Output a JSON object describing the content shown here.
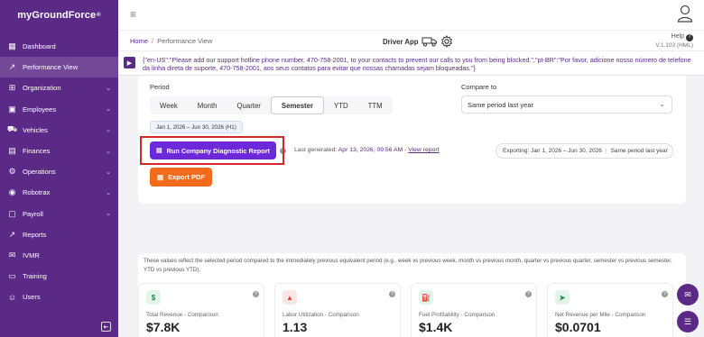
{
  "brand": {
    "name": "myGroundForce",
    "mark": "®"
  },
  "sidebar": {
    "items": [
      {
        "label": "Dashboard",
        "icon": "dashboard-icon",
        "glyph": "▦",
        "chevron": false
      },
      {
        "label": "Performance View",
        "icon": "chart-icon",
        "glyph": "↗",
        "chevron": false,
        "active": true
      },
      {
        "label": "Organization",
        "icon": "organization-icon",
        "glyph": "⊞",
        "chevron": true
      },
      {
        "label": "Employees",
        "icon": "employees-icon",
        "glyph": "▣",
        "chevron": true
      },
      {
        "label": "Vehicles",
        "icon": "vehicle-icon",
        "glyph": "⛟",
        "chevron": true
      },
      {
        "label": "Finances",
        "icon": "finances-icon",
        "glyph": "▤",
        "chevron": true
      },
      {
        "label": "Operations",
        "icon": "operations-icon",
        "glyph": "⚙",
        "chevron": true
      },
      {
        "label": "Robotrax",
        "icon": "robot-icon",
        "glyph": "◉",
        "chevron": true
      },
      {
        "label": "Payroll",
        "icon": "payroll-icon",
        "glyph": "▢",
        "chevron": true
      },
      {
        "label": "Reports",
        "icon": "reports-icon",
        "glyph": "↗",
        "chevron": false
      },
      {
        "label": "IVMR",
        "icon": "ivmr-icon",
        "glyph": "✉",
        "chevron": false
      },
      {
        "label": "Training",
        "icon": "training-icon",
        "glyph": "▭",
        "chevron": false
      },
      {
        "label": "Users",
        "icon": "users-icon",
        "glyph": "☺",
        "chevron": false
      }
    ]
  },
  "breadcrumb": {
    "home": "Home",
    "sep": "/",
    "current": "Performance View"
  },
  "driver_app": {
    "label": "Driver App"
  },
  "help": {
    "label": "Help",
    "version": "V.1.103 (HML)"
  },
  "notice": {
    "text": "{\"en-US\":\"Please add our support hotline phone number, 470-758-2001, to your contacts to prevent our calls to you from being blocked.\",\"pt-BR\":\"Por favor, adicione nosso número de telefone da linha direta de suporte, 470-758-2001, aos seus contatos para evitar que nossas chamadas sejam bloqueadas.\"}"
  },
  "period": {
    "label": "Period",
    "tabs": [
      "Week",
      "Month",
      "Quarter",
      "Semester",
      "YTD",
      "TTM"
    ],
    "active": "Semester",
    "range_chip": "Jan 1, 2026 – Jun 30, 2026 (H1)"
  },
  "compare": {
    "label": "Compare to",
    "value": "Same period last year"
  },
  "run_report": {
    "label": "Run Company Diagnostic Report"
  },
  "last_generated": {
    "prefix": "Last generated:",
    "date": "Apr 13, 2026, 09:56 AM",
    "dash": " - ",
    "link": "View report"
  },
  "exporting": {
    "range": "Exporting: Jan 1, 2026 – Jun 30, 2026",
    "compare": "Same period last year"
  },
  "export_pdf": {
    "label": "Export PDF"
  },
  "explanation": "These values reflect the selected period compared to the immediately previous equivalent period (e.g., week vs previous week, month vs previous month, quarter vs previous quarter, semester vs previous semester, YTD vs previous YTD).",
  "kpis": [
    {
      "label": "Total Revenue - Comparison",
      "value": "$7.8K",
      "icon": "dollar-icon",
      "glyph": "$",
      "color": "#1b8a4a",
      "bg": "#e3f5ea"
    },
    {
      "label": "Labor Utilization - Comparison",
      "value": "1.13",
      "icon": "bar-chart-icon",
      "glyph": "▲",
      "color": "#d64545",
      "bg": "#fbe6e6"
    },
    {
      "label": "Fuel Profitability - Comparison",
      "value": "$1.4K",
      "icon": "fuel-icon",
      "glyph": "⛽",
      "color": "#1b8a4a",
      "bg": "#e3f5ea"
    },
    {
      "label": "Net Revenue per Mile - Comparison",
      "value": "$0.0701",
      "icon": "send-icon",
      "glyph": "➤",
      "color": "#1b8a4a",
      "bg": "#e3f5ea"
    }
  ]
}
